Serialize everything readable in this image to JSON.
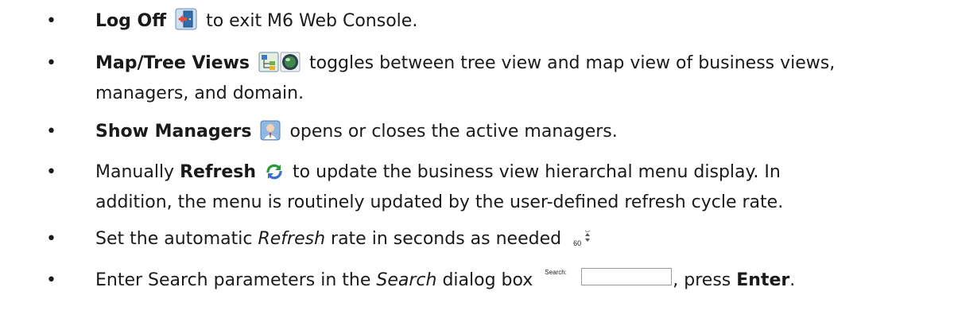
{
  "items": [
    {
      "bold": "Log Off",
      "rest": " to exit M6 Web Console.",
      "icon": "log-off-icon"
    },
    {
      "bold": "Map/Tree Views",
      "rest_line1": " toggles between tree view and map view of business views,",
      "rest_line2": "managers, and domain.",
      "icons": [
        "tree-view-icon",
        "map-view-icon"
      ]
    },
    {
      "bold": "Show Managers",
      "rest": " opens or closes the active managers.",
      "icon": "show-managers-icon"
    },
    {
      "pre": "Manually ",
      "bold": "Refresh",
      "rest_line1": " to update the business view hierarchal menu display.  In",
      "rest_line2": "addition, the menu is routinely updated by the user-defined refresh cycle rate.",
      "icon": "refresh-icon"
    },
    {
      "pre": "Set the automatic ",
      "italic": "Refresh",
      "rest": " rate in seconds as needed",
      "spinner_value": "60",
      "icon": "spinner-arrows-icon"
    },
    {
      "pre": "Enter Search parameters in the ",
      "italic": "Search",
      "mid": " dialog box ",
      "search_label": "Search:",
      "post": ", press ",
      "bold": "Enter",
      "end": "."
    }
  ]
}
